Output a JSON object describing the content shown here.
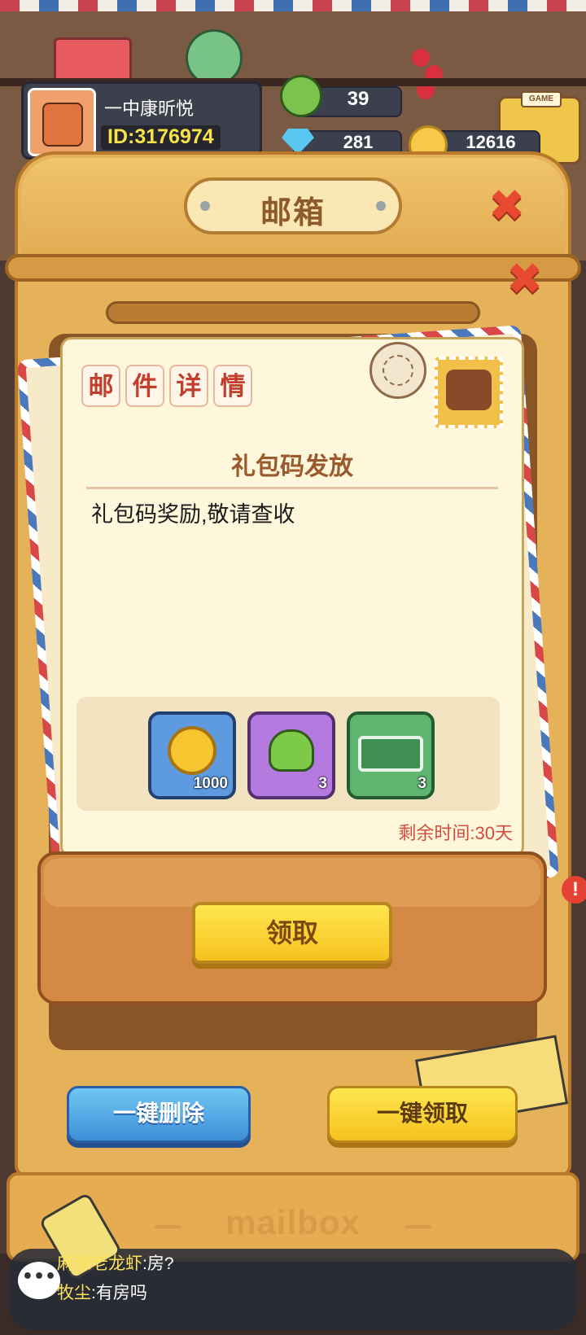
{
  "player": {
    "name": "一中康昕悦",
    "id_label": "ID:3176974"
  },
  "resources": [
    {
      "icon": "frog-token-icon",
      "value": "39"
    },
    {
      "icon": "diamond-icon",
      "value": "281"
    },
    {
      "icon": "coin-icon",
      "value": "12616"
    }
  ],
  "mailbox": {
    "title": "邮箱",
    "detail_tag_chars": [
      "邮",
      "件",
      "详",
      "情"
    ],
    "subject": "礼包码发放",
    "body": "礼包码奖励,敬请查收",
    "rewards": [
      {
        "icon": "gold-coin-icon",
        "count": "1000"
      },
      {
        "icon": "frog-token-icon",
        "count": "3"
      },
      {
        "icon": "treasure-chest-icon",
        "count": "3"
      }
    ],
    "expire_text": "剩余时间:30天",
    "claim_label": "领取",
    "delete_all_label": "一键删除",
    "claim_all_label": "一键领取",
    "footer_text": "mailbox"
  },
  "chat": [
    {
      "name": "麻辣老龙虾",
      "message": ":房?"
    },
    {
      "name": "牧尘",
      "message": ":有房吗"
    }
  ],
  "alert_symbol": "!",
  "colors": {
    "board": "#e5b25a",
    "letter": "#fff7dc",
    "claim_button": "#f5c21f",
    "delete_button": "#3f8fd8",
    "expire_text": "#d24c3e"
  }
}
